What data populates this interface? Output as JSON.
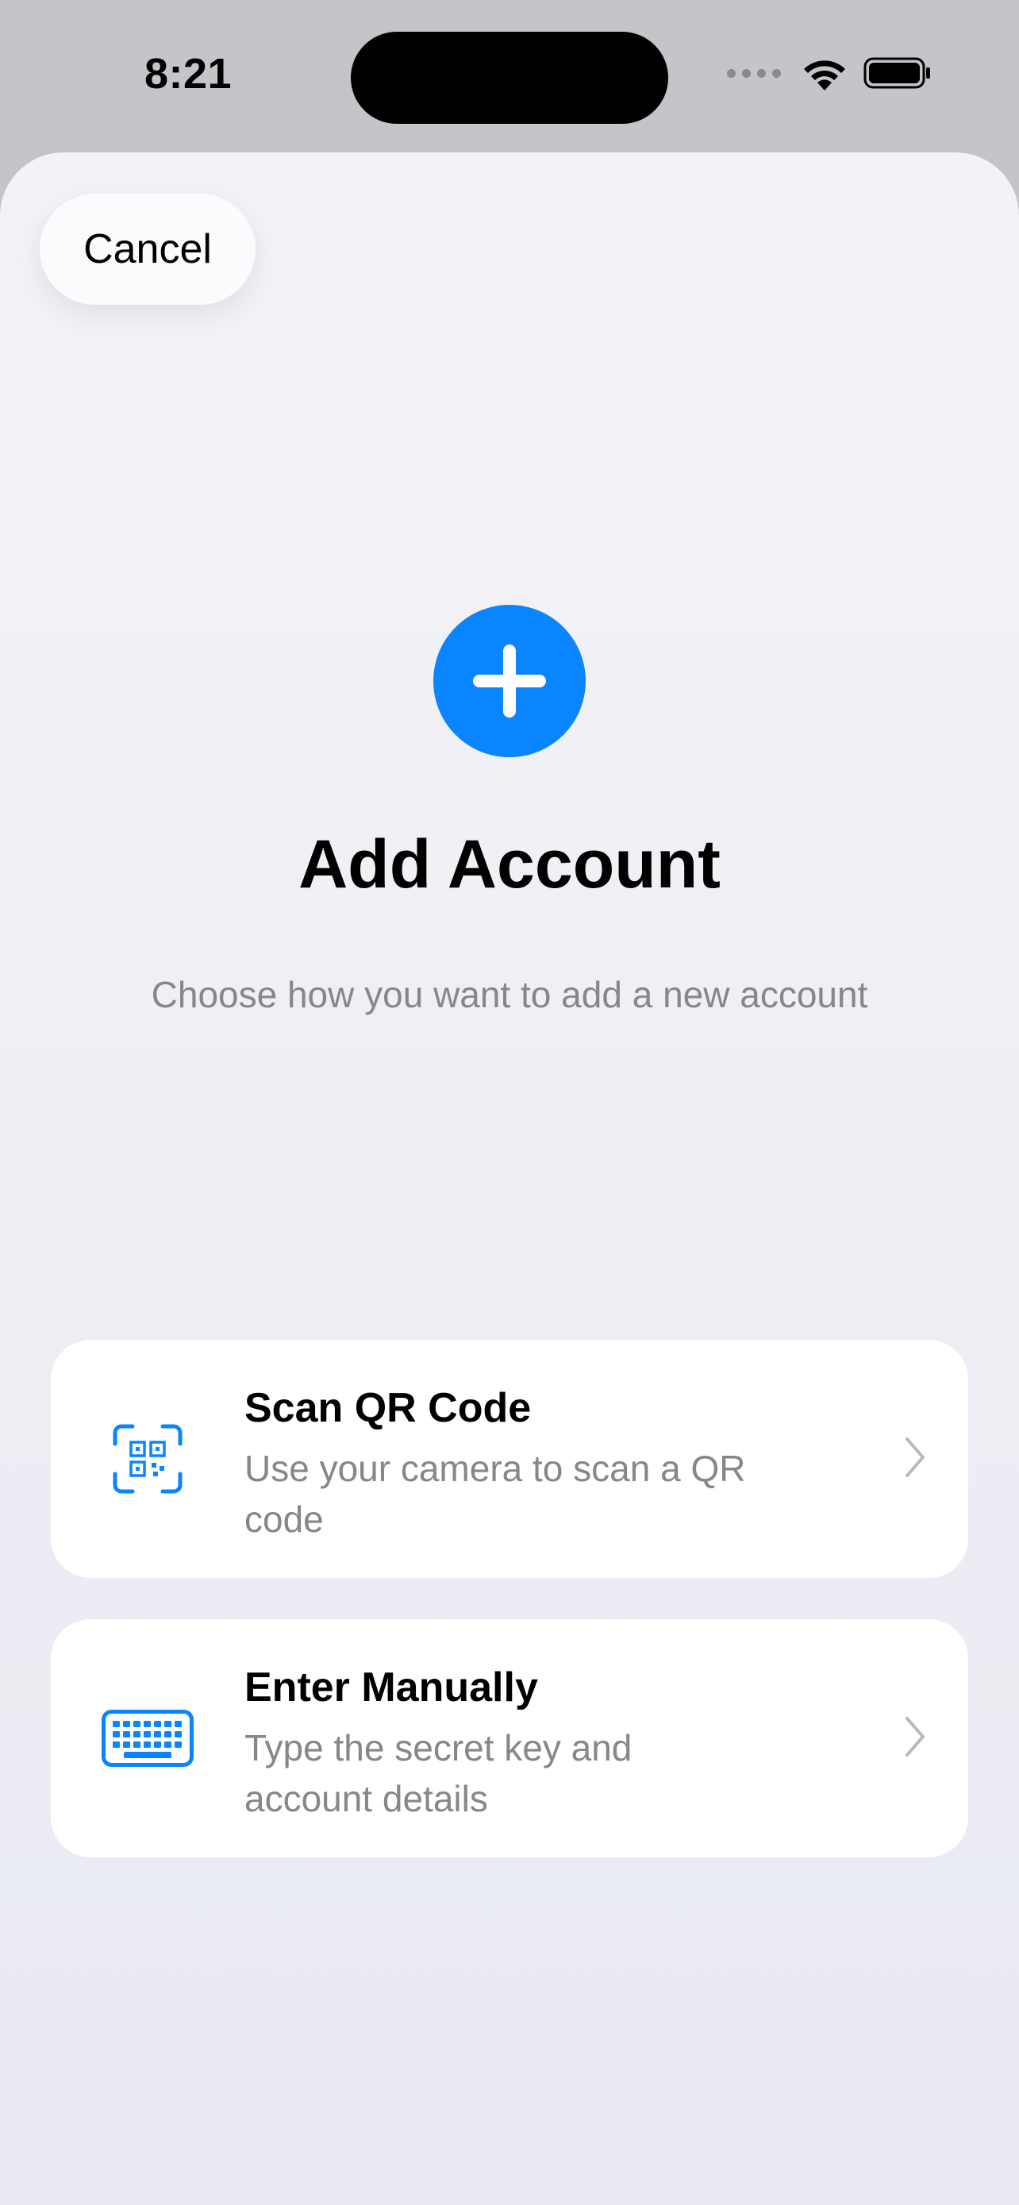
{
  "status_bar": {
    "time": "8:21",
    "icons": [
      "signal-dots-icon",
      "wifi-icon",
      "battery-icon"
    ]
  },
  "header": {
    "cancel_label": "Cancel"
  },
  "main": {
    "icon": "plus-circle-icon",
    "title": "Add Account",
    "subtitle": "Choose how you want to add a new account"
  },
  "options": [
    {
      "icon": "qr-scan-icon",
      "title": "Scan QR Code",
      "description": "Use your camera to scan a QR code"
    },
    {
      "icon": "keyboard-icon",
      "title": "Enter Manually",
      "description": "Type the secret key and account details"
    }
  ],
  "colors": {
    "accent": "#0a84ff",
    "secondary_text": "#86868b",
    "background": "#f3f3f7"
  }
}
